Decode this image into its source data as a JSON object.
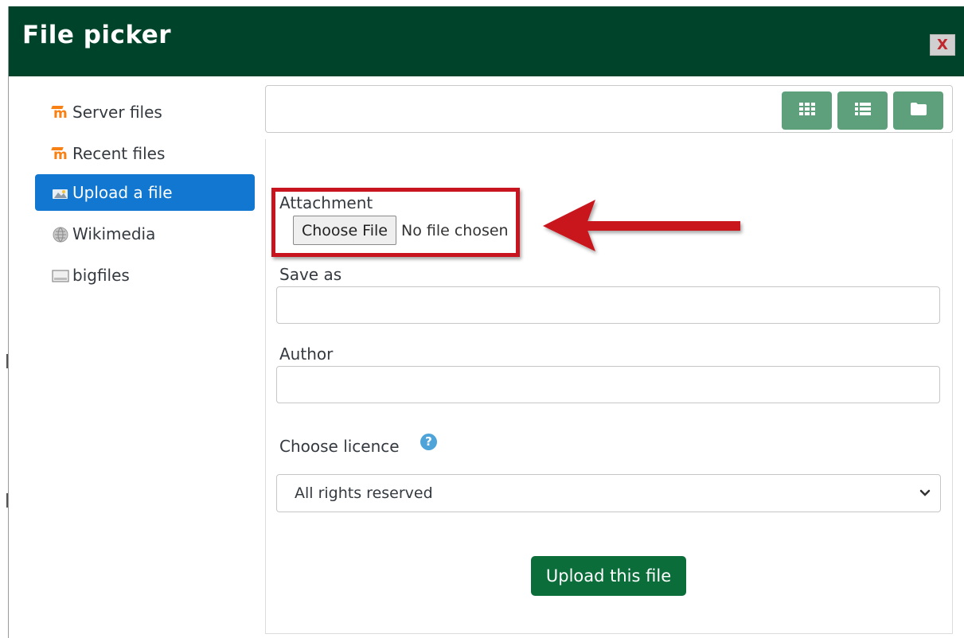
{
  "window": {
    "title": "File picker",
    "close_label": "X"
  },
  "sidebar": {
    "items": [
      {
        "label": "Server files",
        "icon": "moodle-icon",
        "active": false
      },
      {
        "label": "Recent files",
        "icon": "moodle-icon",
        "active": false
      },
      {
        "label": "Upload a file",
        "icon": "upload-icon",
        "active": true
      },
      {
        "label": "Wikimedia",
        "icon": "wikimedia-icon",
        "active": false
      },
      {
        "label": "bigfiles",
        "icon": "disk-icon",
        "active": false
      }
    ]
  },
  "toolbar": {
    "view_buttons": [
      "grid-view-icon",
      "list-view-icon",
      "folder-view-icon"
    ]
  },
  "form": {
    "attachment_label": "Attachment",
    "choose_file_label": "Choose File",
    "no_file_text": "No file chosen",
    "save_as_label": "Save as",
    "save_as_value": "",
    "author_label": "Author",
    "author_value": "",
    "licence_label": "Choose licence",
    "licence_help_icon": "question-circle-icon",
    "licence_selected": "All rights reserved",
    "upload_button": "Upload this file"
  },
  "colors": {
    "header": "#00432b",
    "active_item": "#1177d1",
    "view_button": "#5ea07c",
    "upload_button": "#0b6e3a",
    "annotation": "#c8141e"
  }
}
